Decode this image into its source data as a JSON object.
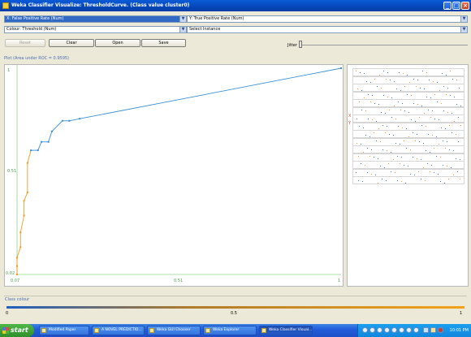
{
  "window": {
    "title": "Weka Classifier Visualize: ThresholdCurve. (Class value cluster0)",
    "buttons": {
      "minimize": "_",
      "maximize": "□",
      "close": "×"
    }
  },
  "controls": {
    "x_axis_select": "X: False Positive Rate (Num)",
    "y_axis_select": "Y: True Positive Rate (Num)",
    "colour_select": "Colour: Threshold (Num)",
    "instance_select": "Select Instance",
    "reset_label": "Reset",
    "clear_label": "Clear",
    "open_label": "Open",
    "save_label": "Save",
    "jitter_label": "Jitter"
  },
  "plot": {
    "title": "Plot (Area under ROC = 0.9595)",
    "x_tick_min": "0.07",
    "x_tick_mid": "0.51",
    "x_tick_max": "1",
    "y_tick_max": "1",
    "y_tick_mid": "0.51",
    "y_tick_min": "0.02",
    "side_x_marker": "X",
    "side_y_marker": "Y"
  },
  "chart_data": {
    "type": "line",
    "title": "Plot (Area under ROC = 0.9595)",
    "xlabel": "",
    "ylabel": "",
    "xlim": [
      0.07,
      1.0
    ],
    "ylim": [
      0.02,
      1.0
    ],
    "x": [
      0.07,
      0.07,
      0.07,
      0.08,
      0.08,
      0.09,
      0.09,
      0.1,
      0.1,
      0.11,
      0.13,
      0.14,
      0.16,
      0.17,
      0.2,
      0.22,
      0.25,
      1.0
    ],
    "y": [
      0.02,
      0.06,
      0.1,
      0.15,
      0.22,
      0.3,
      0.37,
      0.41,
      0.55,
      0.61,
      0.61,
      0.65,
      0.65,
      0.7,
      0.75,
      0.75,
      0.76,
      1.0
    ],
    "series": [
      {
        "color_low": "#f29b1d",
        "color_high": "#3a8fd4"
      }
    ]
  },
  "legend": {
    "title": "Class colour",
    "min_label": "0",
    "mid_label": "0.5",
    "max_label": "1"
  },
  "taskbar": {
    "start_label": "start",
    "tasks": [
      {
        "label": "Modified Paper"
      },
      {
        "label": "A NOVEL PREDICTIO..."
      },
      {
        "label": "Weka GUI Chooser"
      },
      {
        "label": "Weka Explorer"
      },
      {
        "label": "Weka Classifier Visual..."
      }
    ],
    "clock": "10:01 PM"
  }
}
